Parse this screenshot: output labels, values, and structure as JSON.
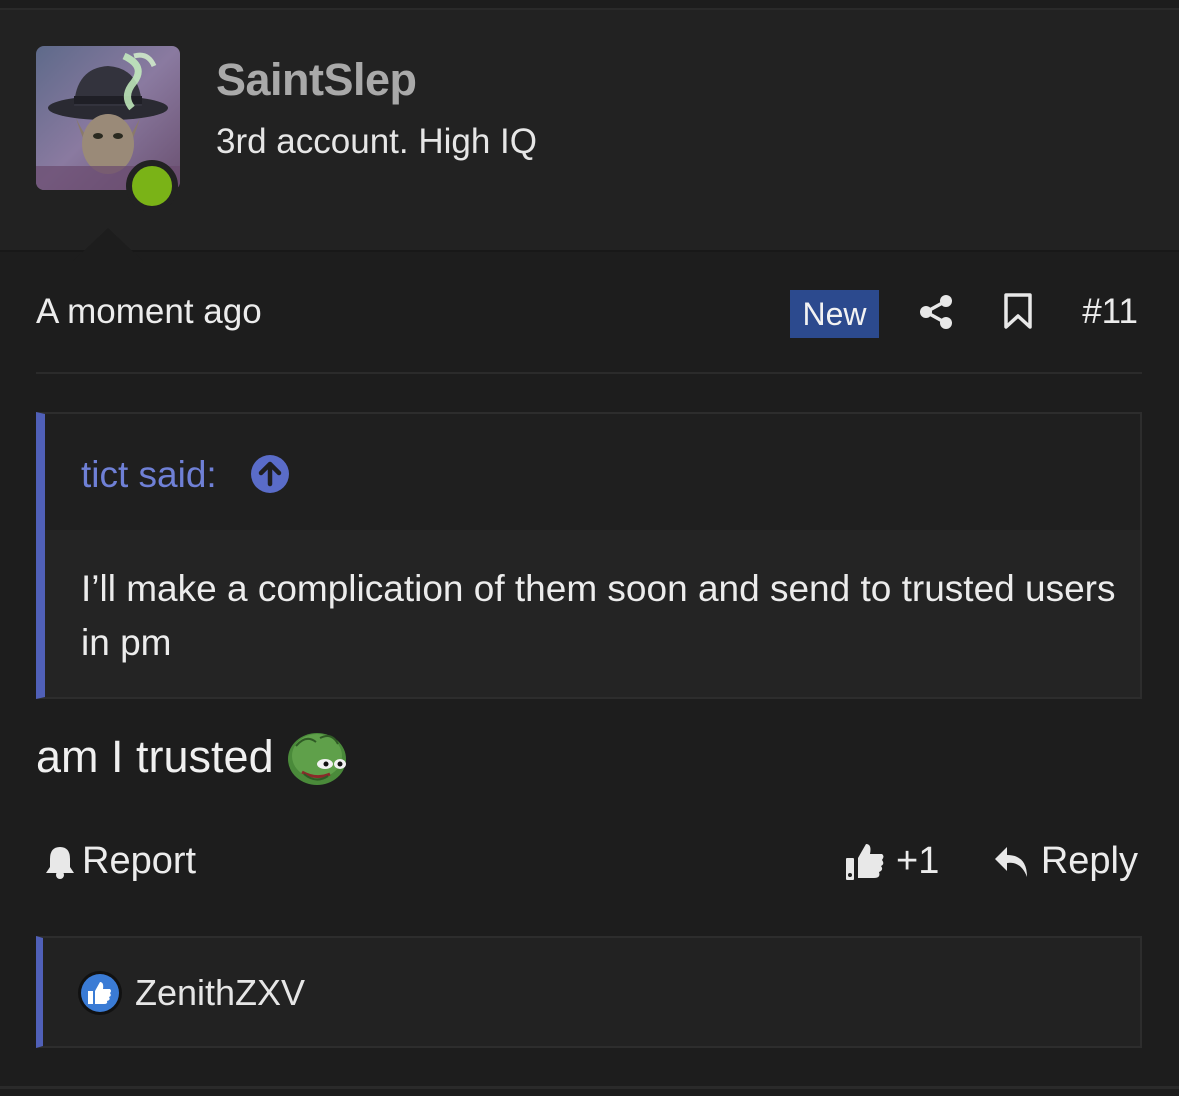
{
  "user": {
    "username": "SaintSlep",
    "title": "3rd account. High IQ",
    "online": true
  },
  "post": {
    "timestamp": "A moment ago",
    "badge": "New",
    "number": "#11",
    "body": "am I trusted",
    "body_emoji": "pepe-emoji"
  },
  "quote": {
    "author": "tict said:",
    "text": "I’ll make a complication of them soon and send to trusted users in pm"
  },
  "actions": {
    "report": "Report",
    "like_count": "+1",
    "reply": "Reply"
  },
  "reactions": {
    "users": [
      "ZenithZXV"
    ]
  },
  "colors": {
    "background": "#1d1d1d",
    "header_bg": "#222222",
    "accent": "#5060b8",
    "quote_author": "#6f80d6",
    "badge_bg": "#2c4a8e",
    "online": "#7ab317",
    "like_icon": "#3a7bd5"
  }
}
